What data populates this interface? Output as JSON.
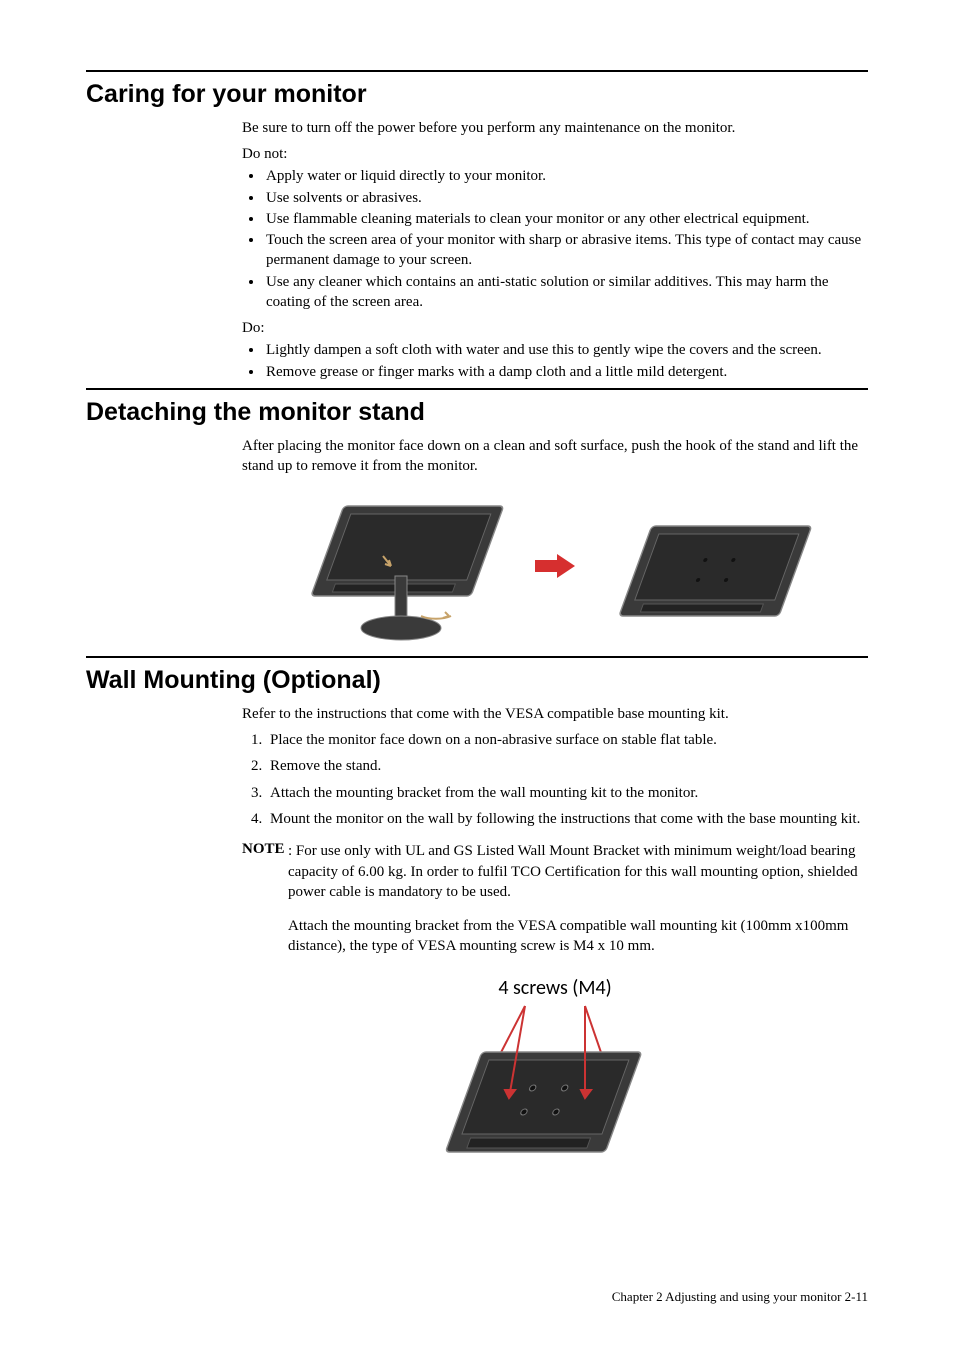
{
  "sections": {
    "caring": {
      "title": "Caring for your monitor",
      "intro": "Be sure to turn off the power before you perform any maintenance on the monitor.",
      "do_not_label": "Do not:",
      "do_not_items": [
        "Apply water or liquid directly to your monitor.",
        "Use solvents or abrasives.",
        "Use flammable cleaning materials to clean your monitor or any other electrical equipment.",
        "Touch the screen area of your monitor with sharp or abrasive items. This type of contact may cause permanent damage to your screen.",
        "Use any cleaner which contains an anti-static solution or similar additives. This may harm the coating of the screen area."
      ],
      "do_label": "Do:",
      "do_items": [
        "Lightly dampen a soft cloth with water and use this to gently wipe the covers and the screen.",
        "Remove grease or finger marks with a damp cloth and a little mild detergent."
      ]
    },
    "detaching": {
      "title": "Detaching the monitor stand",
      "intro": "After placing the monitor face down on a clean and soft surface, push the hook of the stand and lift the stand up to remove it from the monitor."
    },
    "wall": {
      "title": "Wall Mounting (Optional)",
      "intro": "Refer to the instructions that come with the VESA compatible base mounting kit.",
      "steps": [
        "Place the monitor face down on a non-abrasive surface on stable flat table.",
        "Remove the stand.",
        "Attach the mounting bracket from the wall mounting kit to the monitor.",
        "Mount the monitor on the wall by following the instructions that come with the base mounting kit."
      ],
      "note_label": "NOTE",
      "note_body1": ": For use only with UL and GS Listed Wall Mount Bracket with minimum weight/load bearing capacity of 6.00 kg. In order to fulfil TCO Certification for this wall mounting option, shielded power cable is mandatory to be used.",
      "note_body2": "Attach the mounting bracket from the VESA compatible wall mounting kit (100mm x100mm distance), the type of VESA mounting screw is M4 x 10 mm.",
      "fig_label": "4 screws (M4)"
    }
  },
  "footer": "Chapter 2 Adjusting and using your monitor  2-11"
}
